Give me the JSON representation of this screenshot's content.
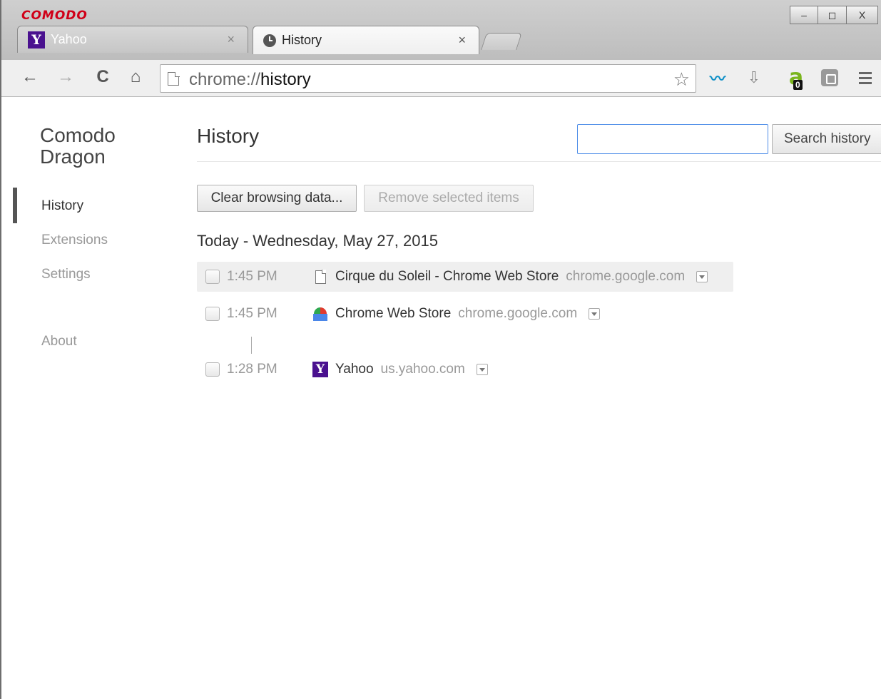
{
  "window": {
    "brand": "COMODO",
    "controls": {
      "minimize": "–",
      "maximize": "◻",
      "close": "X"
    }
  },
  "tabs": [
    {
      "label": "Yahoo",
      "close": "×",
      "active": false
    },
    {
      "label": "History",
      "close": "×",
      "active": true
    }
  ],
  "toolbar": {
    "back": "←",
    "forward": "→",
    "reload": "C",
    "home": "⌂",
    "url_scheme": "chrome://",
    "url_host": "history",
    "star": "☆",
    "wave": "〰",
    "download": "⇩",
    "ext_letter": "a",
    "ext_badge": "0"
  },
  "sidebar": {
    "product_line1": "Comodo",
    "product_line2": "Dragon",
    "items": [
      {
        "label": "History"
      },
      {
        "label": "Extensions"
      },
      {
        "label": "Settings"
      },
      {
        "label": "About"
      }
    ]
  },
  "main": {
    "title": "History",
    "search_placeholder": "",
    "search_button": "Search history",
    "clear_button": "Clear browsing data...",
    "remove_button": "Remove selected items",
    "day_header": "Today - Wednesday, May 27, 2015",
    "entries": [
      {
        "time": "1:45 PM",
        "title": "Cirque du Soleil - Chrome Web Store",
        "domain": "chrome.google.com",
        "icon": "page-icon"
      },
      {
        "time": "1:45 PM",
        "title": "Chrome Web Store",
        "domain": "chrome.google.com",
        "icon": "web-store-icon"
      },
      {
        "time": "1:28 PM",
        "title": "Yahoo",
        "domain": "us.yahoo.com",
        "icon": "yahoo-icon"
      }
    ]
  },
  "icons": {
    "yahoo_letter": "Y"
  },
  "colors": {
    "brand": "#d00018",
    "search_focus": "#4f8ee8",
    "yahoo": "#4a118f",
    "wave_ext": "#0c8fc7",
    "a_ext": "#7ab51d"
  }
}
